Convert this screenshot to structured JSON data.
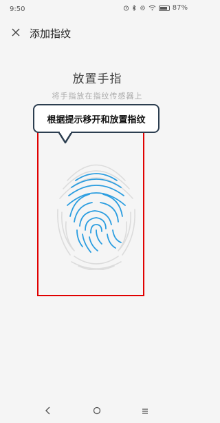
{
  "status_bar": {
    "time": "9:50",
    "battery_percent_text": "87%",
    "battery_level": 0.87,
    "icons": [
      "alarm-icon",
      "bluetooth-icon",
      "gear-icon",
      "wifi-icon",
      "battery-icon"
    ]
  },
  "header": {
    "title": "添加指纹",
    "close_icon": "close-icon"
  },
  "main": {
    "heading": "放置手指",
    "subheading": "将手指放在指纹传感器上",
    "fingerprint_icon": "fingerprint-icon"
  },
  "callout": {
    "text": "根据提示移开和放置指纹"
  },
  "nav_bar": {
    "icons": [
      "back-icon",
      "home-icon",
      "menu-icon"
    ]
  },
  "colors": {
    "accent": "#2a9de0",
    "highlight": "#e00000",
    "callout_border": "#2c3e50"
  }
}
